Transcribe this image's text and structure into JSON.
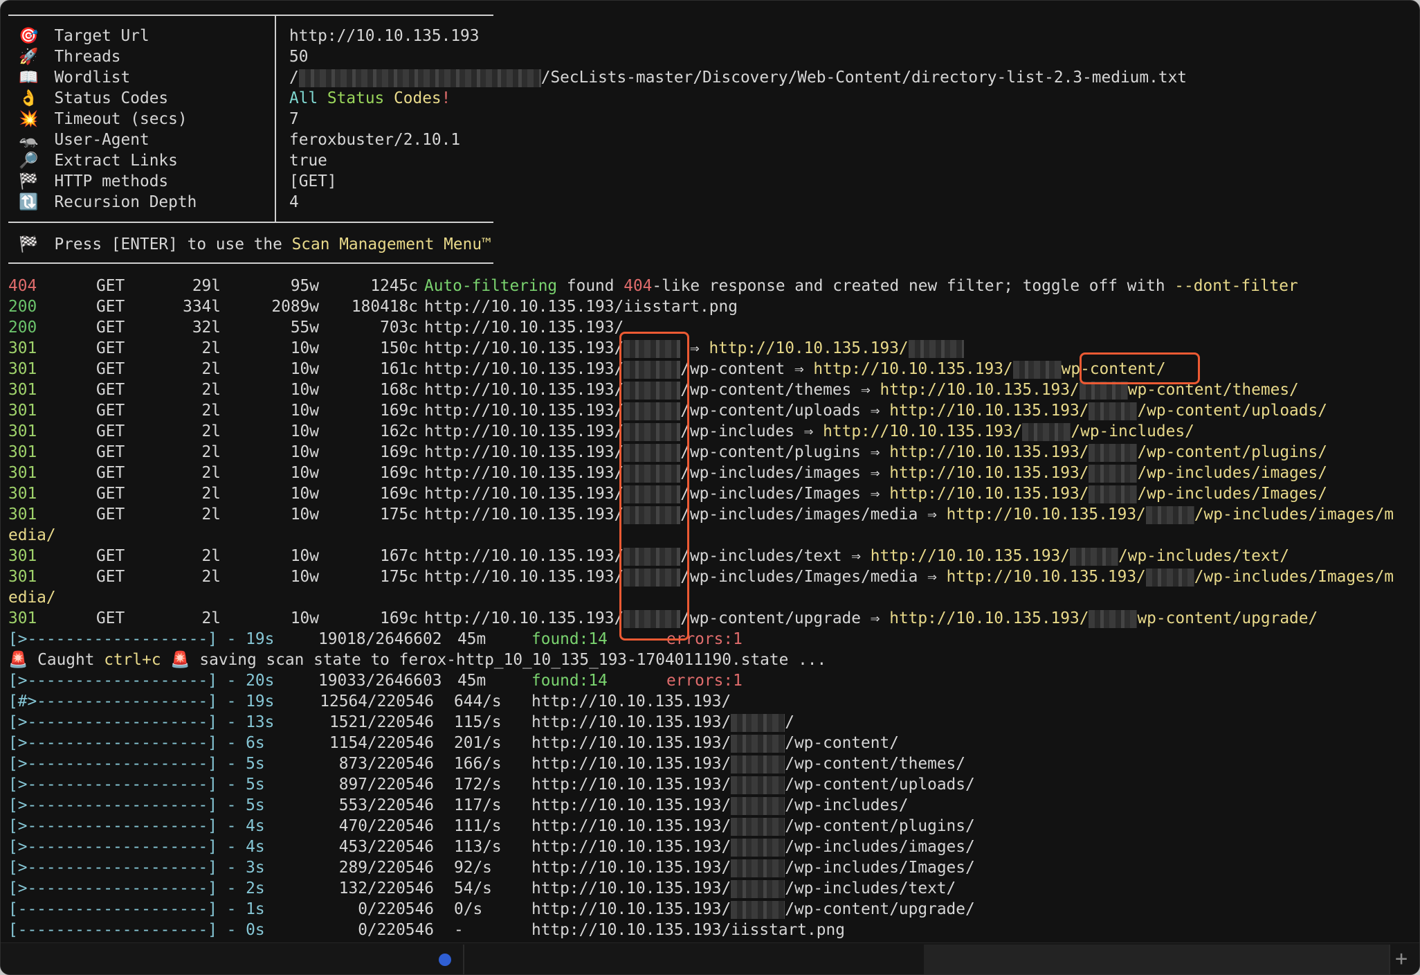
{
  "config": [
    {
      "icon": "🎯",
      "label": "Target Url",
      "value": "http://10.10.135.193",
      "icon_name": "target-icon"
    },
    {
      "icon": "🚀",
      "label": "Threads",
      "value": "50",
      "icon_name": "rocket-icon"
    },
    {
      "icon": "📖",
      "label": "Wordlist",
      "value_prefix": "/",
      "value_suffix": "/SecLists-master/Discovery/Web-Content/directory-list-2.3-medium.txt",
      "icon_name": "book-icon"
    },
    {
      "icon": "👌",
      "label": "Status Codes",
      "value_parts": [
        "All",
        "Status",
        "Codes",
        "!"
      ],
      "icon_name": "ok-hand-icon"
    },
    {
      "icon": "💥",
      "label": "Timeout (secs)",
      "value": "7",
      "icon_name": "collision-icon"
    },
    {
      "icon": "🦡",
      "label": "User-Agent",
      "value": "feroxbuster/2.10.1",
      "icon_name": "badger-icon"
    },
    {
      "icon": "🔎",
      "label": "Extract Links",
      "value": "true",
      "icon_name": "magnifier-icon"
    },
    {
      "icon": "🏁",
      "label": "HTTP methods",
      "value": "[GET]",
      "icon_name": "checkered-flag-icon"
    },
    {
      "icon": "🔃",
      "label": "Recursion Depth",
      "value": "4",
      "icon_name": "recursion-icon"
    }
  ],
  "menu_hint": {
    "icon": "🏁",
    "press": "Press [ENTER] to use the ",
    "menu": "Scan Management Menu™"
  },
  "results": [
    {
      "status": "404",
      "method": "GET",
      "lines": "29l",
      "words": "95w",
      "chars": "1245c"
    },
    {
      "status": "200",
      "method": "GET",
      "lines": "334l",
      "words": "2089w",
      "chars": "180418c"
    },
    {
      "status": "200",
      "method": "GET",
      "lines": "32l",
      "words": "55w",
      "chars": "703c"
    },
    {
      "status": "301",
      "method": "GET",
      "lines": "2l",
      "words": "10w",
      "chars": "150c"
    },
    {
      "status": "301",
      "method": "GET",
      "lines": "2l",
      "words": "10w",
      "chars": "161c"
    },
    {
      "status": "301",
      "method": "GET",
      "lines": "2l",
      "words": "10w",
      "chars": "168c"
    },
    {
      "status": "301",
      "method": "GET",
      "lines": "2l",
      "words": "10w",
      "chars": "169c"
    },
    {
      "status": "301",
      "method": "GET",
      "lines": "2l",
      "words": "10w",
      "chars": "162c"
    },
    {
      "status": "301",
      "method": "GET",
      "lines": "2l",
      "words": "10w",
      "chars": "169c"
    },
    {
      "status": "301",
      "method": "GET",
      "lines": "2l",
      "words": "10w",
      "chars": "169c"
    },
    {
      "status": "301",
      "method": "GET",
      "lines": "2l",
      "words": "10w",
      "chars": "169c"
    },
    {
      "status": "301",
      "method": "GET",
      "lines": "2l",
      "words": "10w",
      "chars": "175c"
    },
    {
      "status": "301",
      "method": "GET",
      "lines": "2l",
      "words": "10w",
      "chars": "167c"
    },
    {
      "status": "301",
      "method": "GET",
      "lines": "2l",
      "words": "10w",
      "chars": "175c"
    },
    {
      "status": "301",
      "method": "GET",
      "lines": "2l",
      "words": "10w",
      "chars": "169c"
    }
  ],
  "result_text": {
    "r404": {
      "a": "Auto-filtering",
      "b": " found ",
      "c": "404",
      "d": "-like response and created new filter; toggle off with ",
      "e": "--dont-filter"
    },
    "r200a": "http://10.10.135.193/iisstart.png",
    "r200b": "http://10.10.135.193/",
    "base": "http://10.10.135.193",
    "arrow": "⇒",
    "paths": [
      "",
      "/wp-content",
      "/wp-content/themes",
      "/wp-content/uploads",
      "/wp-includes",
      "/wp-content/plugins",
      "/wp-includes/images",
      "/wp-includes/Images",
      "/wp-includes/images/media",
      "/wp-includes/text",
      "/wp-includes/Images/media",
      "/wp-content/upgrade"
    ],
    "targets": [
      "",
      "wp-content/",
      "wp-content/themes/",
      "/wp-content/uploads/",
      "/wp-includes/",
      "/wp-content/plugins/",
      "/wp-includes/images/",
      "/wp-includes/Images/",
      "/wp-includes/images/m",
      "/wp-includes/text/",
      "/wp-includes/Images/m",
      "wp-content/upgrade/"
    ],
    "wrap": "edia/"
  },
  "progress_overall_1": {
    "bar": "[>-------------------] - 19s",
    "count": "19018/2646602",
    "eta": "45m",
    "found": "found:14",
    "errors": "errors:1"
  },
  "ctrlc": {
    "a": " Caught ",
    "b": "ctrl+c",
    "c": " saving scan state to ferox-http_10_10_135_193-1704011190.state ..."
  },
  "progress_overall_2": {
    "bar": "[>-------------------] - 20s",
    "count": "19033/2646603",
    "eta": "45m",
    "found": "found:14",
    "errors": "errors:1"
  },
  "progress": [
    {
      "bar": "[#>------------------] - 19s",
      "count": "12564/220546",
      "rate": "644/s",
      "url": "http://10.10.135.193/",
      "suffix": ""
    },
    {
      "bar": "[>-------------------] - 13s",
      "count": "1521/220546",
      "rate": "115/s",
      "url": "http://10.10.135.193/",
      "suffix": "/"
    },
    {
      "bar": "[>-------------------] - 6s",
      "count": "1154/220546",
      "rate": "201/s",
      "url": "http://10.10.135.193/",
      "suffix": "/wp-content/"
    },
    {
      "bar": "[>-------------------] - 5s",
      "count": "873/220546",
      "rate": "166/s",
      "url": "http://10.10.135.193/",
      "suffix": "/wp-content/themes/"
    },
    {
      "bar": "[>-------------------] - 5s",
      "count": "897/220546",
      "rate": "172/s",
      "url": "http://10.10.135.193/",
      "suffix": "/wp-content/uploads/"
    },
    {
      "bar": "[>-------------------] - 5s",
      "count": "553/220546",
      "rate": "117/s",
      "url": "http://10.10.135.193/",
      "suffix": "/wp-includes/"
    },
    {
      "bar": "[>-------------------] - 4s",
      "count": "470/220546",
      "rate": "111/s",
      "url": "http://10.10.135.193/",
      "suffix": "/wp-content/plugins/"
    },
    {
      "bar": "[>-------------------] - 4s",
      "count": "453/220546",
      "rate": "113/s",
      "url": "http://10.10.135.193/",
      "suffix": "/wp-includes/images/"
    },
    {
      "bar": "[>-------------------] - 3s",
      "count": "289/220546",
      "rate": "92/s",
      "url": "http://10.10.135.193/",
      "suffix": "/wp-includes/Images/"
    },
    {
      "bar": "[>-------------------] - 2s",
      "count": "132/220546",
      "rate": "54/s",
      "url": "http://10.10.135.193/",
      "suffix": "/wp-includes/text/"
    },
    {
      "bar": "[--------------------] - 1s",
      "count": "0/220546",
      "rate": "0/s",
      "url": "http://10.10.135.193/",
      "suffix": "/wp-content/upgrade/"
    },
    {
      "bar": "[--------------------] - 0s",
      "count": "0/220546",
      "rate": "-",
      "url": "http://10.10.135.193/iisstart.png",
      "suffix": ""
    }
  ],
  "taskbar": {
    "plus": "+",
    "accent": "#2f5fd4",
    "highlight": "#ec5a33"
  }
}
